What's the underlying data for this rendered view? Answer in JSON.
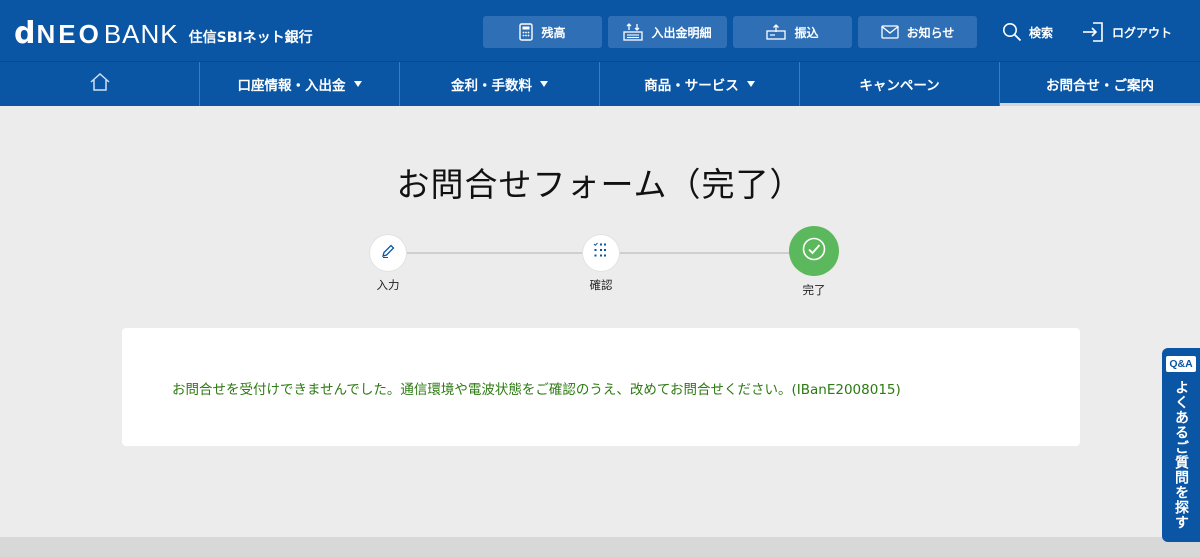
{
  "header": {
    "logo": {
      "d": "d",
      "neo": "NEO",
      "bank": "BANK",
      "sub": "住信SBIネット銀行"
    },
    "buttons": [
      {
        "label": "残高",
        "icon": "calculator-icon"
      },
      {
        "label": "入出金明細",
        "icon": "transfer-list-icon"
      },
      {
        "label": "振込",
        "icon": "transfer-icon"
      },
      {
        "label": "お知らせ",
        "icon": "mail-icon"
      }
    ],
    "search_label": "検索",
    "logout_label": "ログアウト"
  },
  "nav": {
    "home_icon": "home-icon",
    "items": [
      {
        "label": "口座情報・入出金",
        "has_menu": true
      },
      {
        "label": "金利・手数料",
        "has_menu": true
      },
      {
        "label": "商品・サービス",
        "has_menu": true
      },
      {
        "label": "キャンペーン",
        "has_menu": false
      },
      {
        "label": "お問合せ・ご案内",
        "has_menu": false,
        "active": true
      }
    ]
  },
  "main": {
    "title": "お問合せフォーム（完了）",
    "steps": [
      {
        "label": "入力",
        "icon": "pencil-icon",
        "state": "done"
      },
      {
        "label": "確認",
        "icon": "checklist-icon",
        "state": "done"
      },
      {
        "label": "完了",
        "icon": "check-circle-icon",
        "state": "current"
      }
    ],
    "message": "お問合せを受付けできませんでした。通信環境や電波状態をご確認のうえ、改めてお問合せください。(IBanE2008015)"
  },
  "faq_tab": {
    "badge": "Q&A",
    "label": "よくあるご質問を探す"
  },
  "colors": {
    "brand": "#0a55a4",
    "button": "#2f6fb6",
    "complete_green": "#5cb85c",
    "message_green": "#2c7a12",
    "background": "#ececec"
  }
}
